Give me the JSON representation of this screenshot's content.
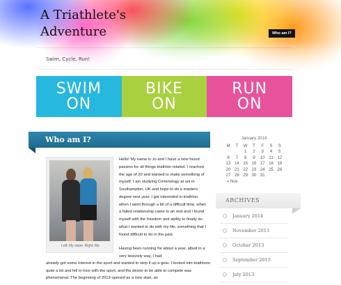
{
  "header": {
    "title_line1": "A Triathlete's",
    "title_line2": "Adventure",
    "nav_button": "Who am I?",
    "tagline": "Swim, Cycle, Run!"
  },
  "banner": {
    "panels": [
      {
        "line1": "SWIM",
        "line2": "ON",
        "color": "#27b8e0"
      },
      {
        "line1": "BIKE",
        "line2": "ON",
        "color": "#a9d03f"
      },
      {
        "line1": "RUN",
        "line2": "ON",
        "color": "#e8529d"
      }
    ]
  },
  "post": {
    "title": "Who am I?",
    "photo_caption": "Left: My sister. Right: Me",
    "paragraph1": "Hello! My name is Jo and I have a new found passion for all things triathlon related. I reached the age of 20 and wanted to make something of myself. I am studying Criminology at uni in Southampton, UK and hope to do a masters degree next year. I got interested in triathlon when I went through a bit of a difficult time, when a failed relationship came to an end and I found myself with the freedom and ability to finally do what I wanted to do with my life, something that I found difficult to do in the past.",
    "paragraph2_start": "Having been running for about a year, albeit in a very leisurely way, I had",
    "paragraph2_rest": "already got some interest in the sport and wanted to step it up a gear. I looked into triathlons quite a bit and fell in love with the sport, and the desire to be able to compete was phenomenal. The beginning of 2013 opened as a new start, an"
  },
  "calendar": {
    "caption": "January 2014",
    "weekdays": [
      "M",
      "T",
      "W",
      "T",
      "F",
      "S",
      "S"
    ],
    "weeks": [
      [
        "",
        "",
        "1",
        "2",
        "3",
        "4",
        "5"
      ],
      [
        "6",
        "7",
        "8",
        "9",
        "10",
        "11",
        "12"
      ],
      [
        "13",
        "14",
        "15",
        "16",
        "17",
        "18",
        "19"
      ],
      [
        "20",
        "21",
        "22",
        "23",
        "24",
        "25",
        "26"
      ],
      [
        "27",
        "28",
        "29",
        "30",
        "31",
        "",
        ""
      ]
    ],
    "prev_link": "« Nov"
  },
  "archives": {
    "heading": "ARCHIVES",
    "items": [
      "January 2014",
      "November 2013",
      "October 2013",
      "September 2013",
      "July 2013"
    ]
  }
}
